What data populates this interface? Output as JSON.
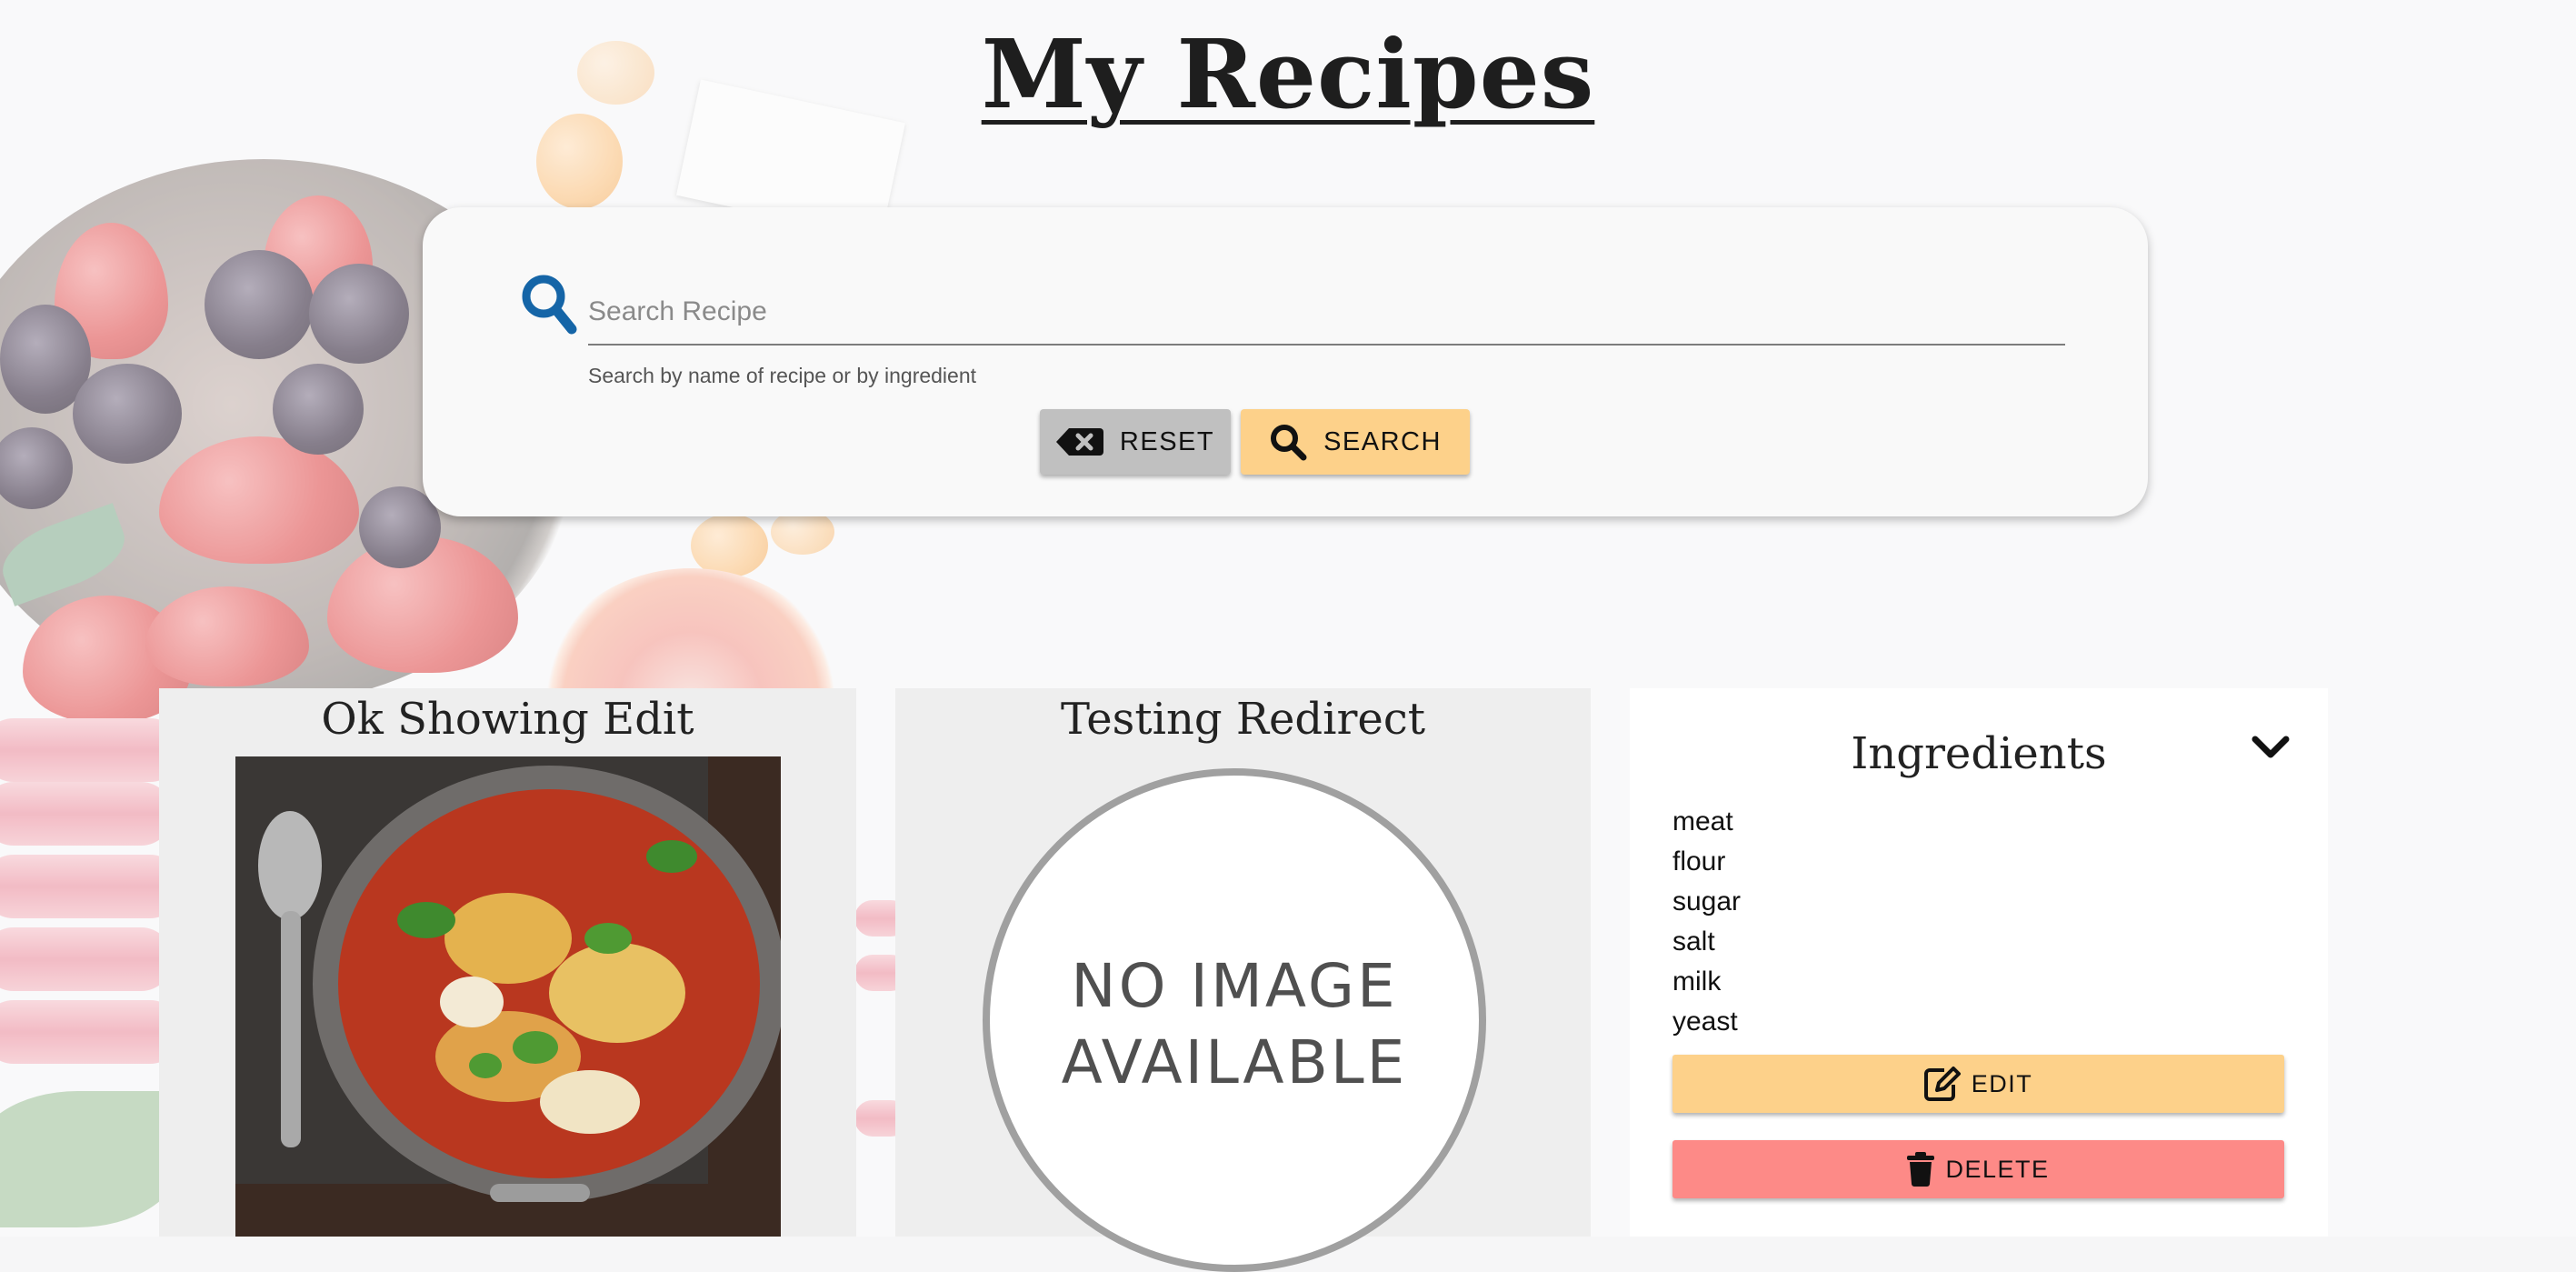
{
  "page": {
    "title": "My Recipes"
  },
  "search": {
    "placeholder": "Search Recipe",
    "value": "",
    "hint": "Search by name of recipe or by ingredient",
    "reset_label": "RESET",
    "search_label": "SEARCH"
  },
  "recipes": [
    {
      "title": "Ok Showing Edit",
      "image": "gnocchi-bake-photo"
    },
    {
      "title": "Testing Redirect",
      "image_placeholder": "NO IMAGE AVAILABLE"
    }
  ],
  "ingredients_card": {
    "title": "Ingredients",
    "items": [
      "meat",
      "flour",
      "sugar",
      "salt",
      "milk",
      "yeast"
    ],
    "edit_label": "EDIT",
    "delete_label": "DELETE"
  },
  "icons": {
    "search": "search-icon",
    "reset": "backspace-x-icon",
    "search_button": "search-icon",
    "toggle": "chevron-down-icon",
    "edit": "edit-pencil-icon",
    "delete": "trash-icon"
  },
  "colors": {
    "accent_blue": "#1565a7",
    "search_button": "#fdd18a",
    "reset_button": "#c0c0c0",
    "edit_button": "#fdd18a",
    "delete_button": "#fd8a87"
  }
}
